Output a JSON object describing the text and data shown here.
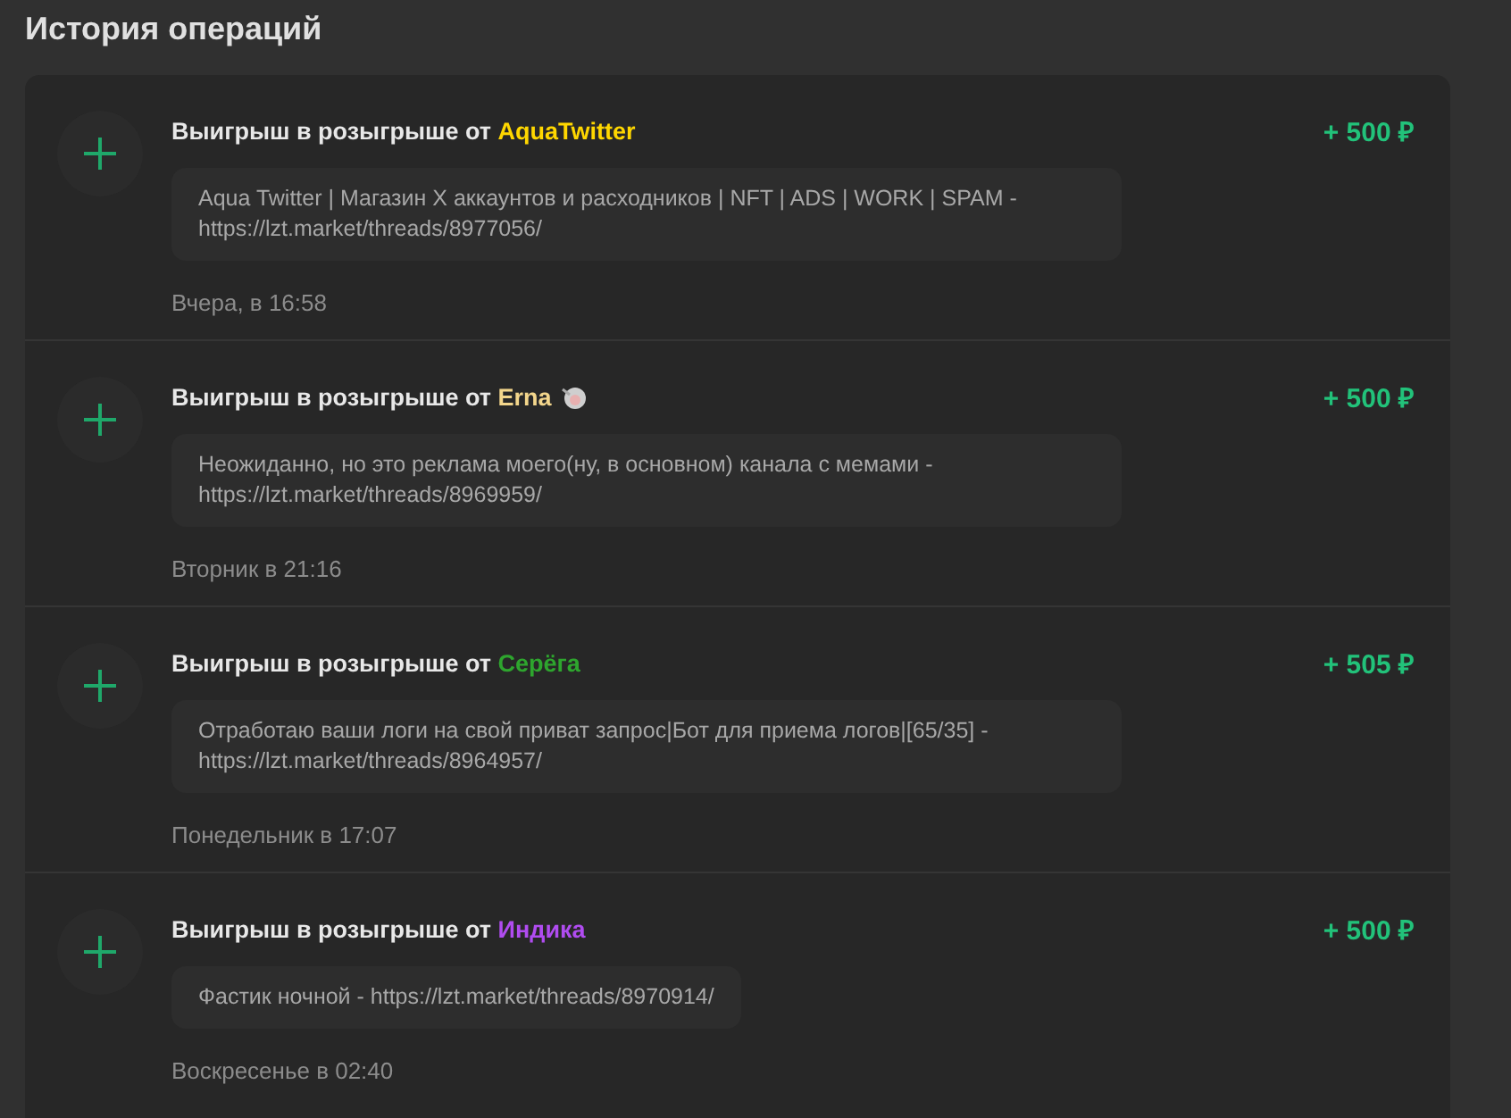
{
  "page_title": "История операций",
  "operations": [
    {
      "title_prefix": "Выигрыш в розыгрыше от",
      "sender": "AquaTwitter",
      "color": "#ffd700",
      "sender_icon": false,
      "amount": "+ 500 ₽",
      "message": "Aqua Twitter | Магазин X аккаунтов и расходников | NFT | ADS | WORK | SPAM - https://lzt.market/threads/8977056/",
      "time": "Вчера, в 16:58"
    },
    {
      "title_prefix": "Выигрыш в розыгрыше от",
      "sender": "Erna",
      "color": "#f3d68c",
      "sender_icon": true,
      "amount": "+ 500 ₽",
      "message": "Неожиданно, но это реклама моего(ну, в основном) канала с мемами - https://lzt.market/threads/8969959/",
      "time": "Вторник в 21:16"
    },
    {
      "title_prefix": "Выигрыш в розыгрыше от",
      "sender": "Серёга",
      "color": "#2ea52e",
      "sender_icon": false,
      "amount": "+ 505 ₽",
      "message": "Отработаю ваши логи на свой приват запрос|Бот для приема логов|[65/35] - https://lzt.market/threads/8964957/",
      "time": "Понедельник в 17:07"
    },
    {
      "title_prefix": "Выигрыш в розыгрыше от",
      "sender": "Индика",
      "color": "#b04cf0",
      "sender_icon": false,
      "amount": "+ 500 ₽",
      "message": "Фастик ночной - https://lzt.market/threads/8970914/",
      "time": "Воскресенье в 02:40"
    }
  ]
}
